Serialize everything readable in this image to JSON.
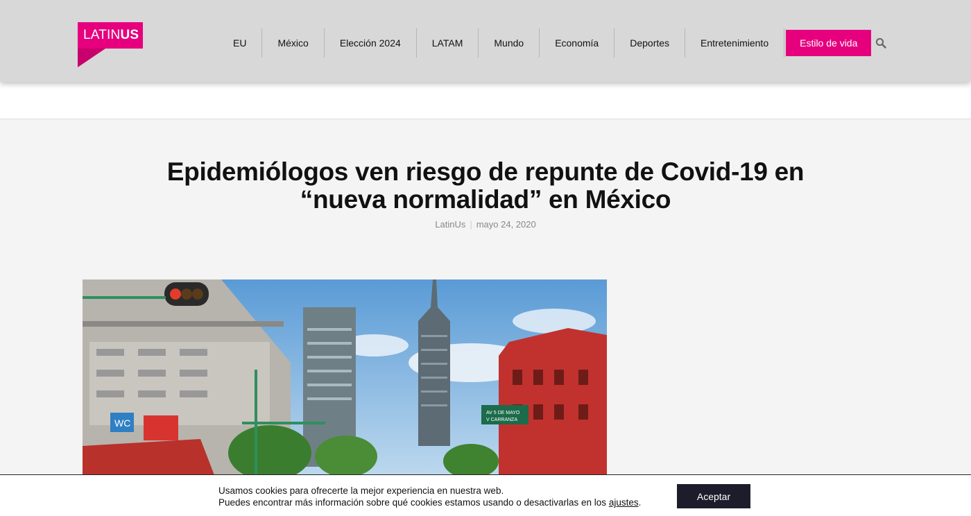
{
  "brand": {
    "logo_regular": "LATIN",
    "logo_bold": "US",
    "color": "#e6007e"
  },
  "nav": {
    "items": [
      {
        "label": "EU"
      },
      {
        "label": "México"
      },
      {
        "label": "Elección 2024"
      },
      {
        "label": "LATAM"
      },
      {
        "label": "Mundo"
      },
      {
        "label": "Economía"
      },
      {
        "label": "Deportes"
      },
      {
        "label": "Entretenimiento"
      },
      {
        "label": "Estilo de vida",
        "active": true
      }
    ],
    "search_icon": "search-icon"
  },
  "article": {
    "title_line1": "Epidemiólogos ven riesgo de repunte de Covid-19 en",
    "title_line2": "“nueva normalidad” en México",
    "author": "LatinUs",
    "separator": "|",
    "date": "mayo 24, 2020",
    "hero_sign_line1": "AV 5 DE MAYO",
    "hero_sign_line2": "V CARRANZA",
    "hero_wc": "WC"
  },
  "cookie_bar": {
    "line1": "Usamos cookies para ofrecerte la mejor experiencia en nuestra web.",
    "line2_prefix": "Puedes encontrar más información sobre qué cookies estamos usando o desactivarlas en los ",
    "link": "ajustes",
    "line2_suffix": ".",
    "accept_label": "Aceptar",
    "button_color": "#1c1c2a"
  }
}
